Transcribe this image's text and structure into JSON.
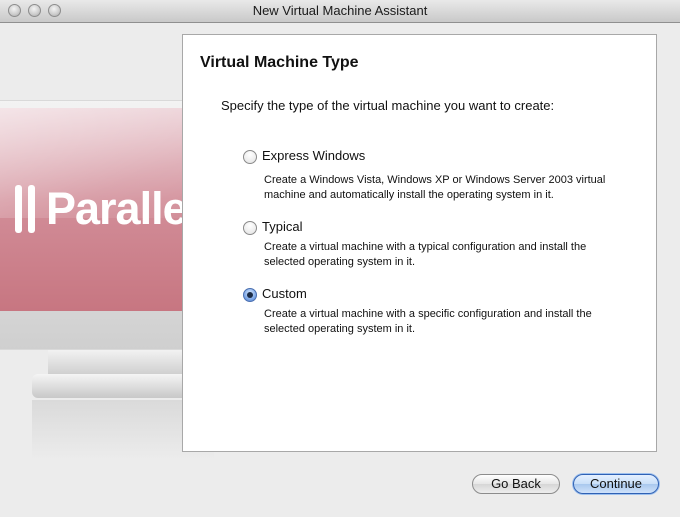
{
  "window": {
    "title": "New Virtual Machine Assistant",
    "controls": [
      "close-icon",
      "minimize-icon",
      "zoom-icon"
    ]
  },
  "illustration": {
    "logo_text": "Parallels",
    "logo_tm": "™"
  },
  "main": {
    "heading": "Virtual Machine Type",
    "prompt": "Specify the type of the virtual machine you want to create:",
    "options": [
      {
        "label": "Express Windows",
        "desc_line1": "Create a Windows Vista, Windows XP or Windows Server 2003 virtual",
        "desc_line2": "machine and automatically install the operating system in it.",
        "selected": false
      },
      {
        "label": "Typical",
        "desc_line1": "Create a virtual machine with a typical configuration and install the",
        "desc_line2": "selected operating system in it.",
        "selected": false
      },
      {
        "label": "Custom",
        "desc_line1": "Create a virtual machine with a specific configuration and install the",
        "desc_line2": "selected operating system in it.",
        "selected": true
      }
    ]
  },
  "footer": {
    "back_label": "Go Back",
    "continue_label": "Continue"
  }
}
